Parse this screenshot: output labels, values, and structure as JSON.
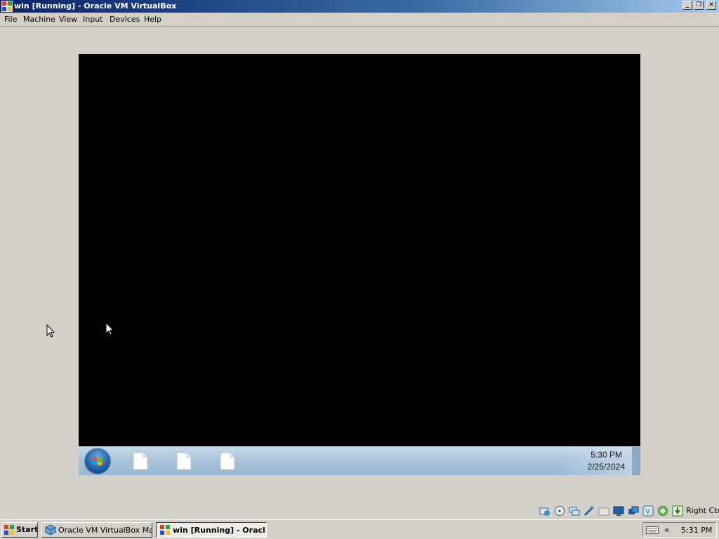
{
  "window": {
    "title": "win [Running] - Oracle VM VirtualBox",
    "controls": [
      "minimize",
      "restore",
      "close"
    ]
  },
  "menu": {
    "items": [
      "File",
      "Machine",
      "View",
      "Input",
      "Devices",
      "Help"
    ]
  },
  "guest": {
    "time": "5:30 PM",
    "date": "2/25/2024",
    "taskbar_apps": [
      "file-icon",
      "file-icon",
      "file-icon"
    ]
  },
  "statusbar": {
    "icons": [
      "hard-disk-icon",
      "optical-drive-icon",
      "audio-icon",
      "usb-icon",
      "shared-folders-icon",
      "display-icon",
      "network-icon",
      "recording-icon",
      "virtualization-icon",
      "mouse-integration-icon",
      "keyboard-capture-icon"
    ],
    "host_key": "Right Ctrl"
  },
  "taskbar": {
    "start_label": "Start",
    "buttons": [
      {
        "label": "Oracle VM VirtualBox Ma...",
        "active": false
      },
      {
        "label": "win [Running] - Oracl...",
        "active": true
      }
    ],
    "tray_chevron": "«",
    "clock": "5:31 PM"
  }
}
